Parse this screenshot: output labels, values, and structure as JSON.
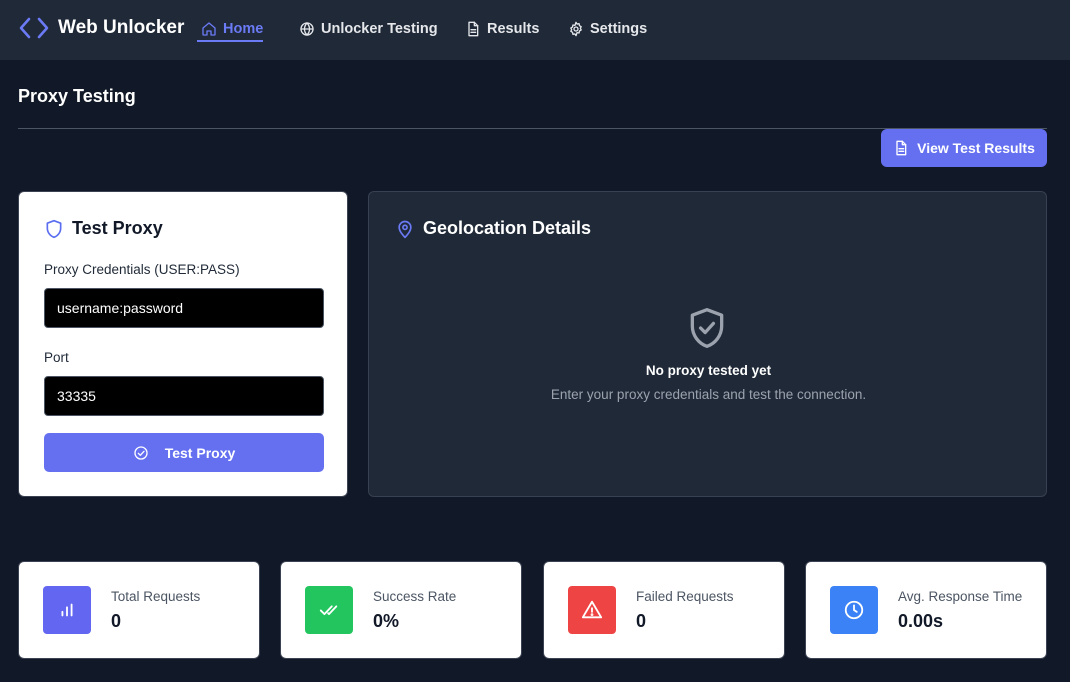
{
  "app": {
    "title": "Web Unlocker"
  },
  "nav": {
    "items": [
      {
        "label": "Home",
        "icon": "home-icon",
        "active": true
      },
      {
        "label": "Unlocker Testing",
        "icon": "globe-icon"
      },
      {
        "label": "Results",
        "icon": "document-icon"
      },
      {
        "label": "Settings",
        "icon": "gear-icon"
      }
    ]
  },
  "page": {
    "title": "Proxy Testing",
    "view_results_label": "View Test Results"
  },
  "test_proxy": {
    "title": "Test Proxy",
    "credentials_label": "Proxy Credentials (USER:PASS)",
    "credentials_value": "username:password",
    "port_label": "Port",
    "port_value": "33335",
    "button_label": "Test Proxy"
  },
  "geolocation": {
    "title": "Geolocation Details",
    "empty_title": "No proxy tested yet",
    "empty_subtitle": "Enter your proxy credentials and test the connection."
  },
  "stats": [
    {
      "label": "Total Requests",
      "value": "0",
      "icon": "bar-chart-icon",
      "color": "#6366f1"
    },
    {
      "label": "Success Rate",
      "value": "0%",
      "icon": "double-check-icon",
      "color": "#22c55e"
    },
    {
      "label": "Failed Requests",
      "value": "0",
      "icon": "warning-icon",
      "color": "#ef4444"
    },
    {
      "label": "Avg. Response Time",
      "value": "0.00s",
      "icon": "clock-icon",
      "color": "#3b82f6"
    }
  ],
  "colors": {
    "accent": "#6470f0",
    "background": "#111827",
    "nav_bg": "#1f2937"
  }
}
